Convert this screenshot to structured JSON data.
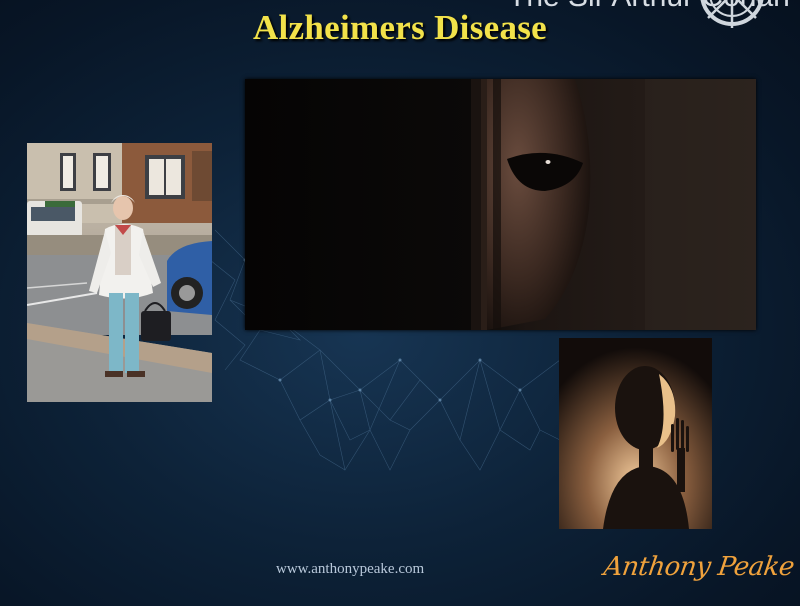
{
  "slide": {
    "title": "Alzheimers Disease",
    "overlay_text": "The Sir Arthur Conan",
    "website": "www.anthonypeake.com",
    "signature": "Anthony Peake"
  },
  "images": [
    {
      "subject": "elderly-woman-street-photo"
    },
    {
      "subject": "alien-eye-peering-through-door"
    },
    {
      "subject": "backlit-alien-silhouette-waving"
    }
  ],
  "colors": {
    "background": "#0d2238",
    "title": "#f2e24a",
    "signature": "#f0a23c",
    "website": "#b8c8da"
  }
}
